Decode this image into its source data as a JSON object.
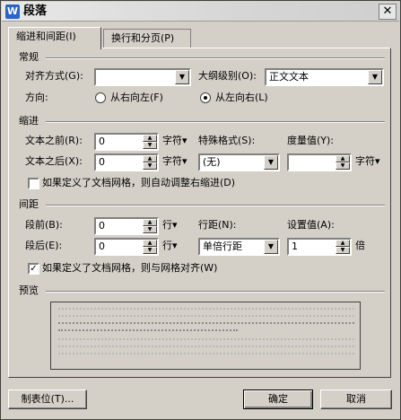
{
  "window": {
    "title": "段落",
    "app_icon_letter": "W",
    "close_symbol": "✕"
  },
  "tabs": [
    {
      "label": "缩进和间距(I)",
      "active": true
    },
    {
      "label": "换行和分页(P)",
      "active": false
    }
  ],
  "general": {
    "section": "常规",
    "alignment_label": "对齐方式(G):",
    "alignment_value": "",
    "outline_label": "大纲级别(O):",
    "outline_value": "正文文本",
    "direction_label": "方向:",
    "rtl_label": "从右向左(F)",
    "ltr_label": "从左向右(L)",
    "selected_direction": "ltr"
  },
  "indent": {
    "section": "缩进",
    "before_label": "文本之前(R):",
    "before_value": "0",
    "before_unit": "字符▾",
    "after_label": "文本之后(X):",
    "after_value": "0",
    "after_unit": "字符▾",
    "special_label": "特殊格式(S):",
    "special_value": "(无)",
    "measure_label": "度量值(Y):",
    "measure_value": "",
    "measure_unit": "字符▾",
    "auto_adjust_label": "如果定义了文档网格，则自动调整右缩进(D)",
    "auto_adjust_checked": false
  },
  "spacing": {
    "section": "间距",
    "before_label": "段前(B):",
    "before_value": "0",
    "before_unit": "行▾",
    "after_label": "段后(E):",
    "after_value": "0",
    "after_unit": "行▾",
    "line_label": "行距(N):",
    "line_value": "单倍行距",
    "setting_label": "设置值(A):",
    "setting_value": "1",
    "setting_unit": "倍",
    "grid_align_label": "如果定义了文档网格，则与网格对齐(W)",
    "grid_align_checked": true
  },
  "preview": {
    "section": "预览"
  },
  "buttons": {
    "tabs": "制表位(T)...",
    "ok": "确定",
    "cancel": "取消"
  },
  "colors": {
    "dialog_bg": "#d4d0c8",
    "icon_blue": "#2a63c9"
  }
}
